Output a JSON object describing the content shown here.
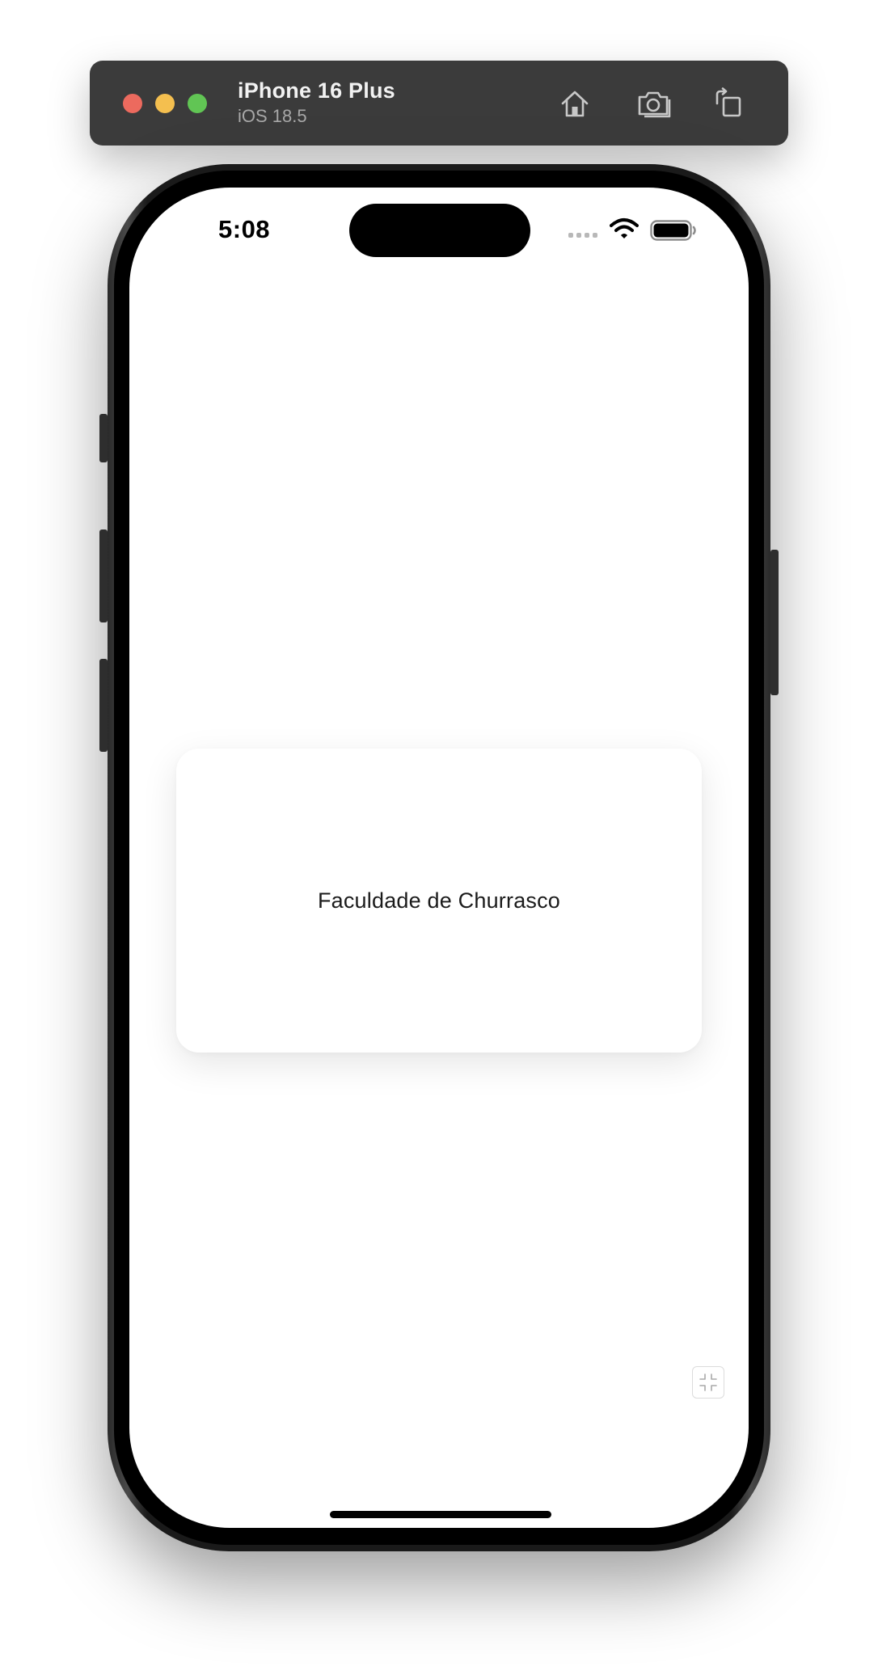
{
  "window": {
    "device_name": "iPhone 16 Plus",
    "os_version": "iOS 18.5"
  },
  "status_bar": {
    "time": "5:08"
  },
  "card": {
    "title": "Faculdade de Churrasco"
  },
  "icons": {
    "home": "home-icon",
    "screenshot": "camera-icon",
    "rotate": "rotate-icon",
    "collapse": "collapse-icon"
  },
  "colors": {
    "toolbar": "#3b3b3b",
    "close": "#ec6a5e",
    "minimize": "#f4bf4f",
    "zoom": "#61c554"
  }
}
